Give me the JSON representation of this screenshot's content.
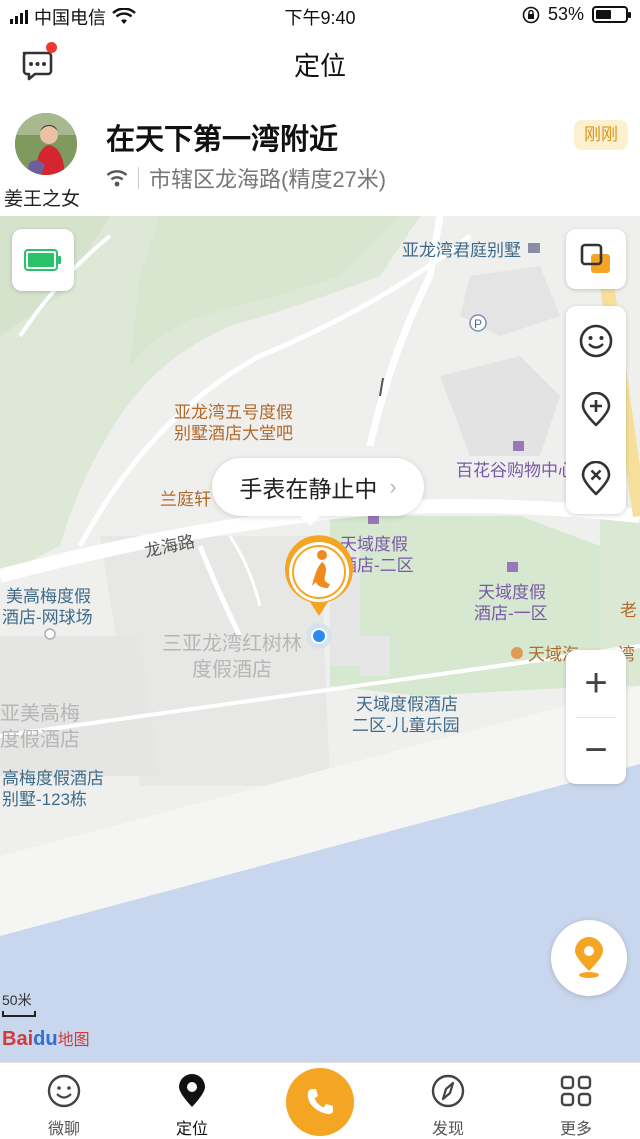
{
  "status_bar": {
    "carrier": "中国电信",
    "time": "下午9:40",
    "battery_percent_text": "53%",
    "battery_level": 0.53
  },
  "nav": {
    "title": "定位"
  },
  "location": {
    "user_name": "姜王之女",
    "place": "在天下第一湾附近",
    "time_badge": "刚刚",
    "address": "市辖区龙海路(精度27米)"
  },
  "map": {
    "status_bubble": "手表在静止中",
    "scale_label": "50米",
    "logo_bai": "Bai",
    "logo_du": "du",
    "logo_map": "地图",
    "zoom_in": "+",
    "zoom_out": "−",
    "pois": {
      "p1": "亚龙湾君庭别墅",
      "p2": "亚龙湾五号度假",
      "p2b": "别墅酒店大堂吧",
      "p3": "百花谷购物中心",
      "p4": "兰庭轩",
      "p5": "龙海路",
      "p6": "天域度假",
      "p6b": "酒店-二区",
      "p7": "美高梅度假",
      "p7b": "酒店-网球场",
      "p8": "天域度假",
      "p8b": "酒店-一区",
      "p9": "老",
      "p10": "三亚龙湾红树林",
      "p10b": "度假酒店",
      "p11": "天域海",
      "p11b": "湾",
      "p12": "亚美高梅",
      "p12b": "度假酒店",
      "p13": "天域度假酒店",
      "p13b": "二区-儿童乐园",
      "p14": "高梅度假酒店",
      "p14b": "别墅-123栋"
    }
  },
  "tabs": [
    {
      "label": "微聊",
      "icon": "smile-chat-icon"
    },
    {
      "label": "定位",
      "icon": "location-pin-icon"
    },
    {
      "label": "",
      "icon": "phone-icon"
    },
    {
      "label": "发现",
      "icon": "compass-icon"
    },
    {
      "label": "更多",
      "icon": "grid-icon"
    }
  ],
  "colors": {
    "accent": "#f5a524",
    "badge_bg": "#fdf0cf",
    "badge_text": "#d89617",
    "battery_green": "#29c26a",
    "water": "#c9d7ee"
  }
}
